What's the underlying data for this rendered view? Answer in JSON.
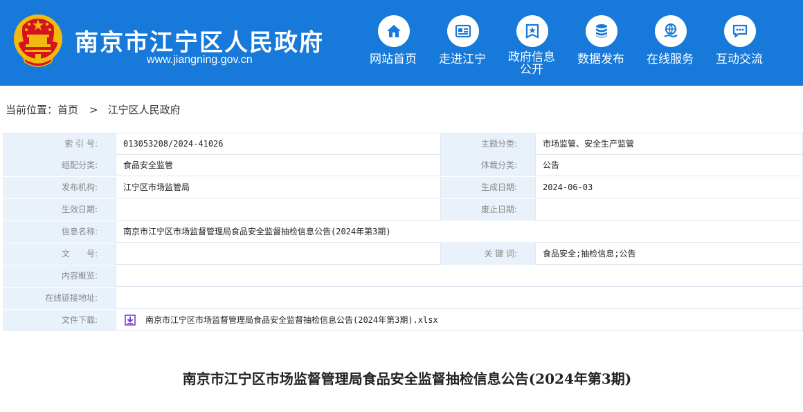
{
  "header": {
    "site_title": "南京市江宁区人民政府",
    "site_url": "www.jiangning.gov.cn",
    "bg_color": "#1779d9",
    "nav": [
      {
        "label": "网站首页",
        "icon": "home-icon"
      },
      {
        "label": "走进江宁",
        "icon": "newspaper-icon"
      },
      {
        "label_line1": "政府信息",
        "label_line2": "公开",
        "icon": "gov-info-icon"
      },
      {
        "label": "数据发布",
        "icon": "database-icon"
      },
      {
        "label": "在线服务",
        "icon": "online-service-icon"
      },
      {
        "label": "互动交流",
        "icon": "chat-icon"
      }
    ]
  },
  "breadcrumb": {
    "prefix": "当前位置：",
    "home": "首页",
    "separator": ">",
    "current": "江宁区人民政府"
  },
  "meta": {
    "index_label": "索 引 号:",
    "index_value": "013053208/2024-41026",
    "topic_label": "主题分类:",
    "topic_value": "市场监管、安全生产监管",
    "org_cat_label": "组配分类:",
    "org_cat_value": "食品安全监管",
    "genre_label": "体裁分类:",
    "genre_value": "公告",
    "publisher_label": "发布机构:",
    "publisher_value": "江宁区市场监管局",
    "created_label": "生成日期:",
    "created_value": "2024-06-03",
    "effective_label": "生效日期:",
    "effective_value": "",
    "abolished_label": "废止日期:",
    "abolished_value": "",
    "name_label": "信息名称:",
    "name_value": "南京市江宁区市场监督管理局食品安全监督抽检信息公告(2024年第3期)",
    "docno_label": "文　　号:",
    "docno_value": "",
    "keywords_label": "关 键 词:",
    "keywords_value": "食品安全;抽检信息;公告",
    "summary_label": "内容概览:",
    "summary_value": "",
    "link_label": "在线链接地址:",
    "link_value": "",
    "download_label": "文件下载:",
    "download_value": "南京市江宁区市场监督管理局食品安全监督抽检信息公告(2024年第3期).xlsx"
  },
  "document": {
    "title": "南京市江宁区市场监督管理局食品安全监督抽检信息公告(2024年第3期)"
  }
}
